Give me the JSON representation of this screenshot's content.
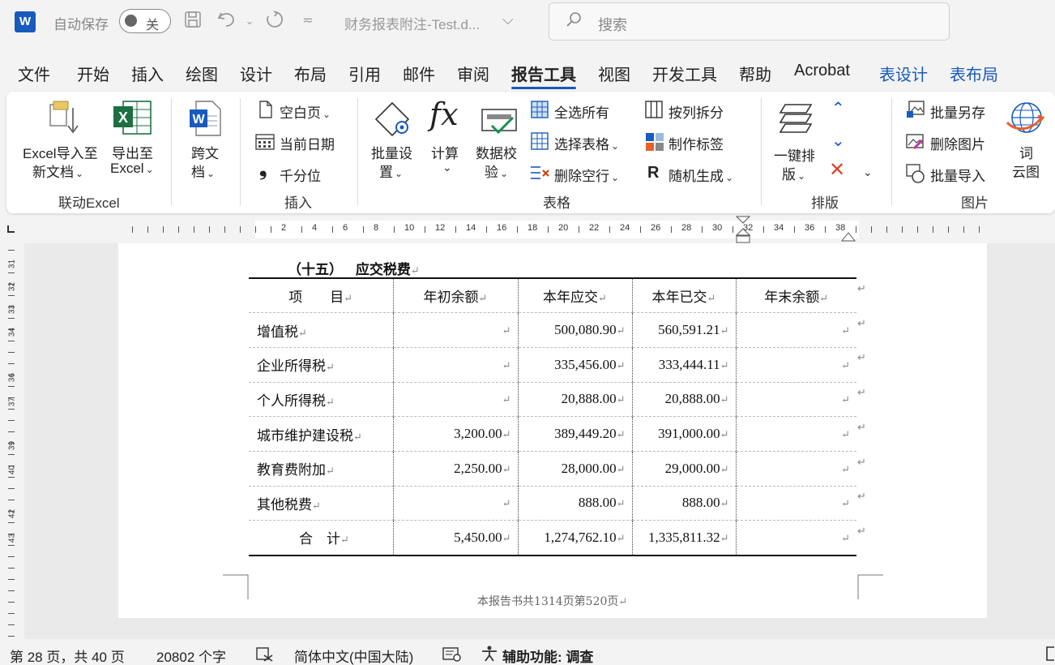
{
  "titlebar": {
    "autosave_label": "自动保存",
    "autosave_state": "关",
    "doc_title": "财务报表附注-Test.d...",
    "search_placeholder": "搜索"
  },
  "menu": {
    "tabs": [
      "文件",
      "开始",
      "插入",
      "绘图",
      "设计",
      "布局",
      "引用",
      "邮件",
      "审阅",
      "报告工具",
      "视图",
      "开发工具",
      "帮助",
      "Acrobat",
      "表设计",
      "表布局"
    ],
    "active": "报告工具"
  },
  "ribbon": {
    "groups": {
      "linked_excel": "联动Excel",
      "insert": "插入",
      "table": "表格",
      "layout": "排版",
      "picture": "图片"
    },
    "excel_import": [
      "Excel导入至",
      "新文档"
    ],
    "export_excel": [
      "导出至",
      "Excel"
    ],
    "cross_doc": [
      "跨文",
      "档"
    ],
    "blank_page": "空白页",
    "current_date": "当前日期",
    "thousands": "千分位",
    "batch_set": [
      "批量设",
      "置"
    ],
    "calculate": "计算",
    "data_check": [
      "数据校",
      "验"
    ],
    "select_all": "全选所有",
    "select_table": "选择表格",
    "delete_empty_rows": "删除空行",
    "split_by_column": "按列拆分",
    "make_label": "制作标签",
    "random_generate": "随机生成",
    "one_click_layout": [
      "一键排",
      "版"
    ],
    "batch_save_as": "批量另存",
    "delete_picture": "删除图片",
    "batch_import": "批量导入",
    "word_cloud": [
      "词",
      "云图"
    ]
  },
  "ruler": {
    "numbers": [
      "2",
      "4",
      "6",
      "8",
      "10",
      "12",
      "14",
      "16",
      "18",
      "20",
      "22",
      "24",
      "26",
      "28",
      "30",
      "32",
      "34",
      "36",
      "38"
    ],
    "vertical_numbers": [
      "31",
      "32",
      "33",
      "34",
      "36",
      "37",
      "39",
      "40",
      "42",
      "43"
    ]
  },
  "document": {
    "heading_num": "（十五）",
    "heading_text": "应交税费",
    "table": {
      "headers": [
        "项　　目",
        "年初余额",
        "本年应交",
        "本年已交",
        "年末余额"
      ],
      "rows": [
        [
          "增值税",
          "",
          "500,080.90",
          "560,591.21",
          ""
        ],
        [
          "企业所得税",
          "",
          "335,456.00",
          "333,444.11",
          ""
        ],
        [
          "个人所得税",
          "",
          "20,888.00",
          "20,888.00",
          ""
        ],
        [
          "城市维护建设税",
          "3,200.00",
          "389,449.20",
          "391,000.00",
          ""
        ],
        [
          "教育费附加",
          "2,250.00",
          "28,000.00",
          "29,000.00",
          ""
        ],
        [
          "其他税费",
          "",
          "888.00",
          "888.00",
          ""
        ],
        [
          "合　计",
          "5,450.00",
          "1,274,762.10",
          "1,335,811.32",
          ""
        ]
      ]
    },
    "footer": "本报告书共1314页第520页"
  },
  "statusbar": {
    "page": "第 28 页，共 40 页",
    "words": "20802 个字",
    "language": "简体中文(中国大陆)",
    "accessibility": "辅助功能: 调查"
  },
  "colors": {
    "word_blue": "#185abd",
    "excel_green": "#1d6f42",
    "accent_orange": "#e8602c"
  }
}
